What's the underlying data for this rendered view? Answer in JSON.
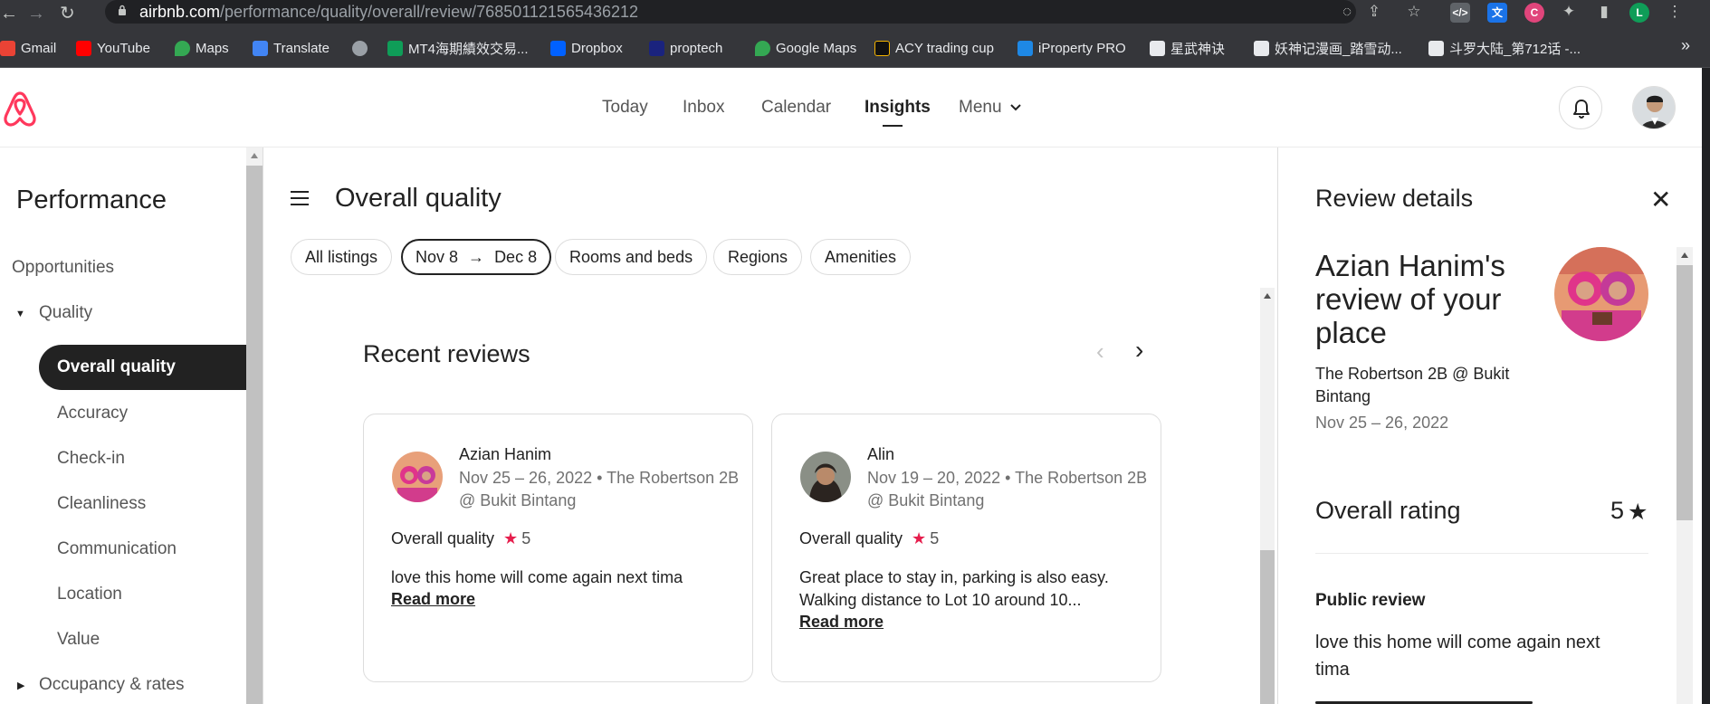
{
  "browser": {
    "url_host": "airbnb.com",
    "url_path": "/performance/quality/overall/review/768501121565436212",
    "extension_initial": "L",
    "bookmarks": [
      {
        "label": "Gmail",
        "color": "#ea4335"
      },
      {
        "label": "YouTube",
        "color": "#ff0000"
      },
      {
        "label": "Maps",
        "color": "#34a853"
      },
      {
        "label": "Translate",
        "color": "#4285f4"
      },
      {
        "label": "",
        "color": "#9aa0a6"
      },
      {
        "label": "MT4海期績效交易...",
        "color": "#0f9d58"
      },
      {
        "label": "Dropbox",
        "color": "#0061ff"
      },
      {
        "label": "proptech",
        "color": "#1a237e"
      },
      {
        "label": "Google Maps",
        "color": "#34a853"
      },
      {
        "label": "ACY trading cup",
        "color": "#111111"
      },
      {
        "label": "iProperty PRO",
        "color": "#1e88e5"
      },
      {
        "label": "星武神诀",
        "color": "#e8eaed"
      },
      {
        "label": "妖神记漫画_踏雪动...",
        "color": "#e8eaed"
      },
      {
        "label": "斗罗大陆_第712话 -...",
        "color": "#e8eaed"
      }
    ],
    "more_label": "»"
  },
  "header": {
    "nav": [
      "Today",
      "Inbox",
      "Calendar",
      "Insights",
      "Menu"
    ],
    "active_nav": "Insights",
    "brand_color": "#ff385c"
  },
  "sidebar": {
    "title": "Performance",
    "opportunities": "Opportunities",
    "quality": "Quality",
    "items": [
      "Overall quality",
      "Accuracy",
      "Check-in",
      "Cleanliness",
      "Communication",
      "Location",
      "Value"
    ],
    "occupancy": "Occupancy & rates"
  },
  "main": {
    "title": "Overall quality",
    "filters": {
      "listings": "All listings",
      "date_from": "Nov 8",
      "arrow": "→",
      "date_to": "Dec 8",
      "rooms": "Rooms and beds",
      "regions": "Regions",
      "amenities": "Amenities"
    },
    "recent_title": "Recent reviews",
    "reviews": [
      {
        "name": "Azian Hanim",
        "meta": "Nov 25 – 26, 2022 • The Robertson 2B @ Bukit Bintang",
        "quality_label": "Overall quality",
        "score": "5",
        "text": "love this home will come again next tima",
        "read_more": "Read more"
      },
      {
        "name": "Alin",
        "meta": "Nov 19 – 20, 2022 • The Robertson 2B @ Bukit Bintang",
        "quality_label": "Overall quality",
        "score": "5",
        "text": "Great place to stay in, parking is also easy. Walking distance to Lot 10 around 10...",
        "read_more": "Read more"
      }
    ],
    "star_color": "#e61e4d"
  },
  "details": {
    "title": "Review details",
    "heading": "Azian Hanim's review of your place",
    "listing": "The Robertson 2B @ Bukit Bintang",
    "dates": "Nov 25 – 26, 2022",
    "overall_label": "Overall rating",
    "overall_value": "5",
    "public_label": "Public review",
    "public_text": "love this home will come again next tima"
  }
}
